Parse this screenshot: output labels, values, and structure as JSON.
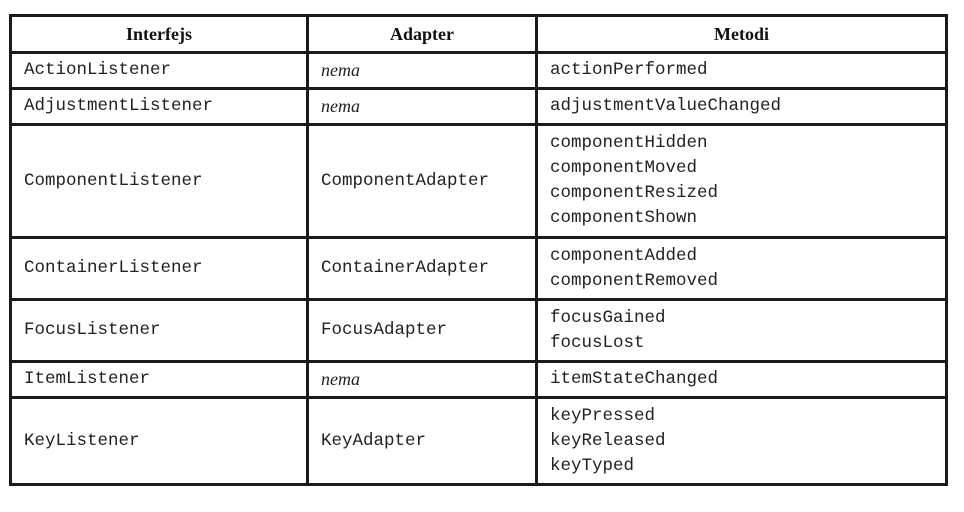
{
  "headers": {
    "interface": "Interfejs",
    "adapter": "Adapter",
    "methods": "Metodi"
  },
  "rows": [
    {
      "interface": "ActionListener",
      "adapter": "nema",
      "adapter_is_none": true,
      "methods": [
        "actionPerformed"
      ]
    },
    {
      "interface": "AdjustmentListener",
      "adapter": "nema",
      "adapter_is_none": true,
      "methods": [
        "adjustmentValueChanged"
      ]
    },
    {
      "interface": "ComponentListener",
      "adapter": "ComponentAdapter",
      "adapter_is_none": false,
      "methods": [
        "componentHidden",
        "componentMoved",
        "componentResized",
        "componentShown"
      ]
    },
    {
      "interface": "ContainerListener",
      "adapter": "ContainerAdapter",
      "adapter_is_none": false,
      "methods": [
        "componentAdded",
        "componentRemoved"
      ]
    },
    {
      "interface": "FocusListener",
      "adapter": "FocusAdapter",
      "adapter_is_none": false,
      "methods": [
        "focusGained",
        "focusLost"
      ]
    },
    {
      "interface": "ItemListener",
      "adapter": "nema",
      "adapter_is_none": true,
      "methods": [
        "itemStateChanged"
      ]
    },
    {
      "interface": "KeyListener",
      "adapter": "KeyAdapter",
      "adapter_is_none": false,
      "methods": [
        "keyPressed",
        "keyReleased",
        "keyTyped"
      ]
    }
  ]
}
